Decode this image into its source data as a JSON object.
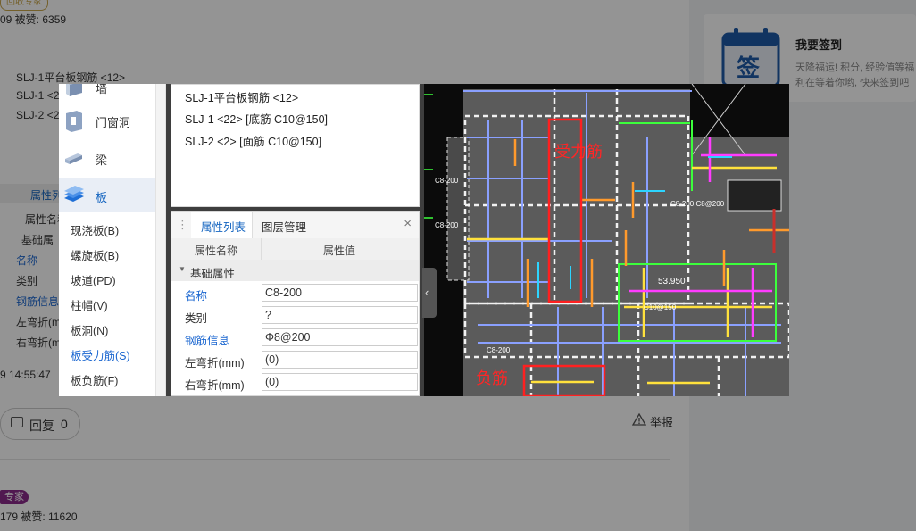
{
  "background": {
    "top_tag": "回收专家",
    "top_stats": "09   被赞:   6359",
    "tree_lines": [
      "SLJ-1平台板钢筋 <12>",
      "SLJ-1 <2",
      "SLJ-2 <2"
    ],
    "prop_tab": "属性列",
    "prop_col": "属性名称",
    "prop_group": "基础属",
    "prop_names": [
      "名称",
      "类别",
      "钢筋信息",
      "左弯折(m",
      "右弯折(m"
    ],
    "timestamp": "9 14:55:47",
    "reply_label": "回复",
    "reply_count": "0",
    "report_label": "举报",
    "second_tag": "专家",
    "second_stats": "179   被赞:   11620"
  },
  "signin": {
    "icon_char": "签",
    "title": "我要签到",
    "desc": "天降福运! 积分, 经验值等福利在等着你哟, 快来签到吧"
  },
  "popup": {
    "menu": [
      {
        "label": "墙",
        "icon": "wall-icon"
      },
      {
        "label": "门窗洞",
        "icon": "door-window-icon"
      },
      {
        "label": "梁",
        "icon": "beam-icon"
      },
      {
        "label": "板",
        "icon": "slab-icon",
        "active": true
      }
    ],
    "submenu": [
      {
        "label": "现浇板(B)"
      },
      {
        "label": "螺旋板(B)"
      },
      {
        "label": "坡道(PD)"
      },
      {
        "label": "柱帽(V)"
      },
      {
        "label": "板洞(N)"
      },
      {
        "label": "板受力筋(S)",
        "active": true
      },
      {
        "label": "板负筋(F)"
      }
    ],
    "tree": [
      "SLJ-1平台板钢筋 <12>",
      "SLJ-1 <22> [底筋 C10@150]",
      "SLJ-2 <2> [面筋 C10@150]"
    ],
    "prop_panel": {
      "tabs": [
        "属性列表",
        "图层管理"
      ],
      "close": "×",
      "col_name": "属性名称",
      "col_value": "属性值",
      "group": "基础属性",
      "rows": [
        {
          "name": "名称",
          "value": "C8-200",
          "blue": true
        },
        {
          "name": "类别",
          "value": "?",
          "blue": false
        },
        {
          "name": "钢筋信息",
          "value": "Φ8@200",
          "blue": true
        },
        {
          "name": "左弯折(mm)",
          "value": "(0)",
          "blue": false
        },
        {
          "name": "右弯折(mm)",
          "value": "(0)",
          "blue": false
        }
      ]
    },
    "cad": {
      "label_main": "受力筋",
      "label_neg": "负筋",
      "elev": "53.950",
      "small_labels": [
        "C8-200",
        "C8-200",
        "C8-200",
        "C10@150",
        "C8-200:C8@200"
      ]
    }
  }
}
